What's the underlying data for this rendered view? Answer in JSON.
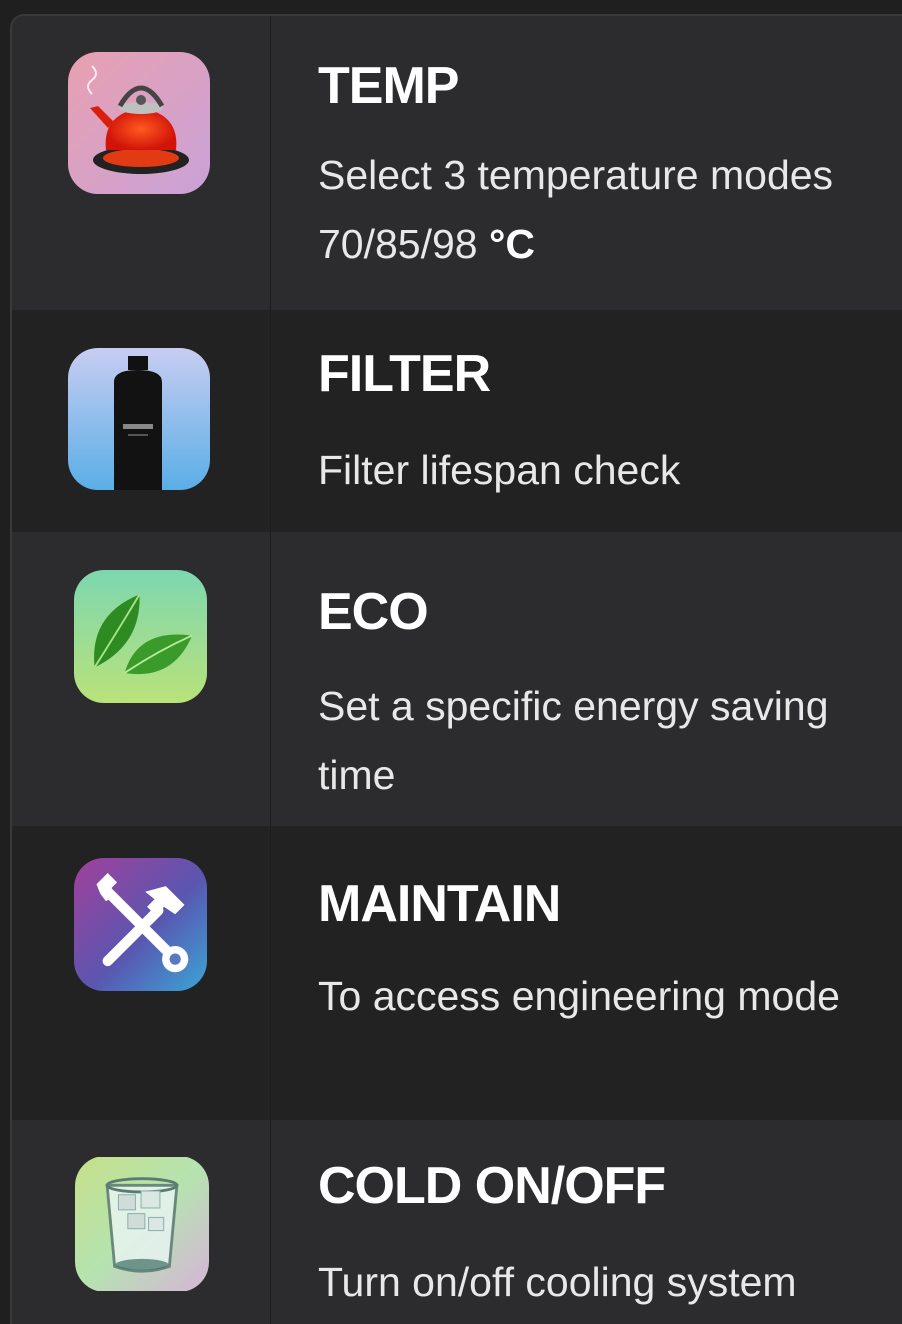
{
  "items": [
    {
      "title": "TEMP",
      "description": "Select 3 temperature modes 70/85/98",
      "unit": "°C",
      "icon": "kettle-icon"
    },
    {
      "title": "FILTER",
      "description": "Filter lifespan check",
      "icon": "filter-cartridge-icon"
    },
    {
      "title": "ECO",
      "description": "Set a specific energy saving time",
      "icon": "leaf-icon"
    },
    {
      "title": "MAINTAIN",
      "description": "To access engineering mode",
      "icon": "tools-icon"
    },
    {
      "title": "COLD ON/OFF",
      "description": "Turn on/off cooling system",
      "icon": "ice-glass-icon"
    }
  ],
  "colors": {
    "row_light": "#2c2b2d",
    "row_dark": "#232223",
    "title_text": "#ffffff",
    "desc_text": "#e8e8e8"
  }
}
